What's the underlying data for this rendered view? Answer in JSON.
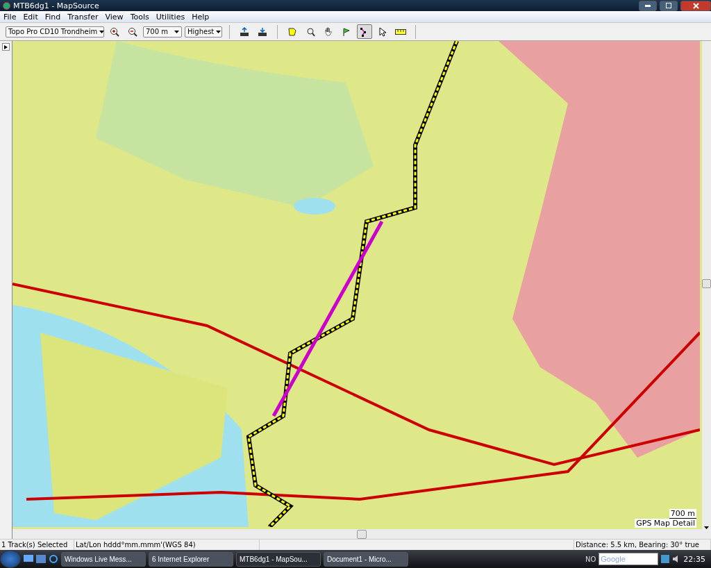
{
  "window": {
    "title": "MTB6dg1 - MapSource"
  },
  "menu": [
    "File",
    "Edit",
    "Find",
    "Transfer",
    "View",
    "Tools",
    "Utilities",
    "Help"
  ],
  "toolbar": {
    "map_product": "Topo Pro CD10 Trondheim",
    "zoom": "700 m",
    "detail": "Highest",
    "tools": [
      {
        "kind": "map-tool",
        "selected": false
      },
      {
        "kind": "zoom-tool",
        "selected": false
      },
      {
        "kind": "hand-tool",
        "selected": false
      },
      {
        "kind": "flag-tool",
        "selected": false
      },
      {
        "kind": "route-tool",
        "selected": true
      },
      {
        "kind": "pointer-tool",
        "selected": false
      },
      {
        "kind": "ruler-tool",
        "selected": false
      }
    ]
  },
  "map": {
    "scale": "700 m",
    "detail_label": "GPS Map Detail"
  },
  "status_bar": [
    "1 Track(s) Selected",
    "Lat/Lon hddd°mm.mmm'(WGS 84)",
    "Distance: 5.5 km, Bearing: 30° true"
  ],
  "taskbar": {
    "tasks": [
      {
        "label": "Windows Live Mess...",
        "selected": false
      },
      {
        "label": "6 Internet Explorer",
        "selected": false
      },
      {
        "label": "MTB6dg1 - MapSou...",
        "selected": true
      },
      {
        "label": "Document1 - Micro...",
        "selected": false
      }
    ],
    "language": "NO",
    "search": {
      "placeholder": "Google"
    },
    "clock": "22:35"
  }
}
